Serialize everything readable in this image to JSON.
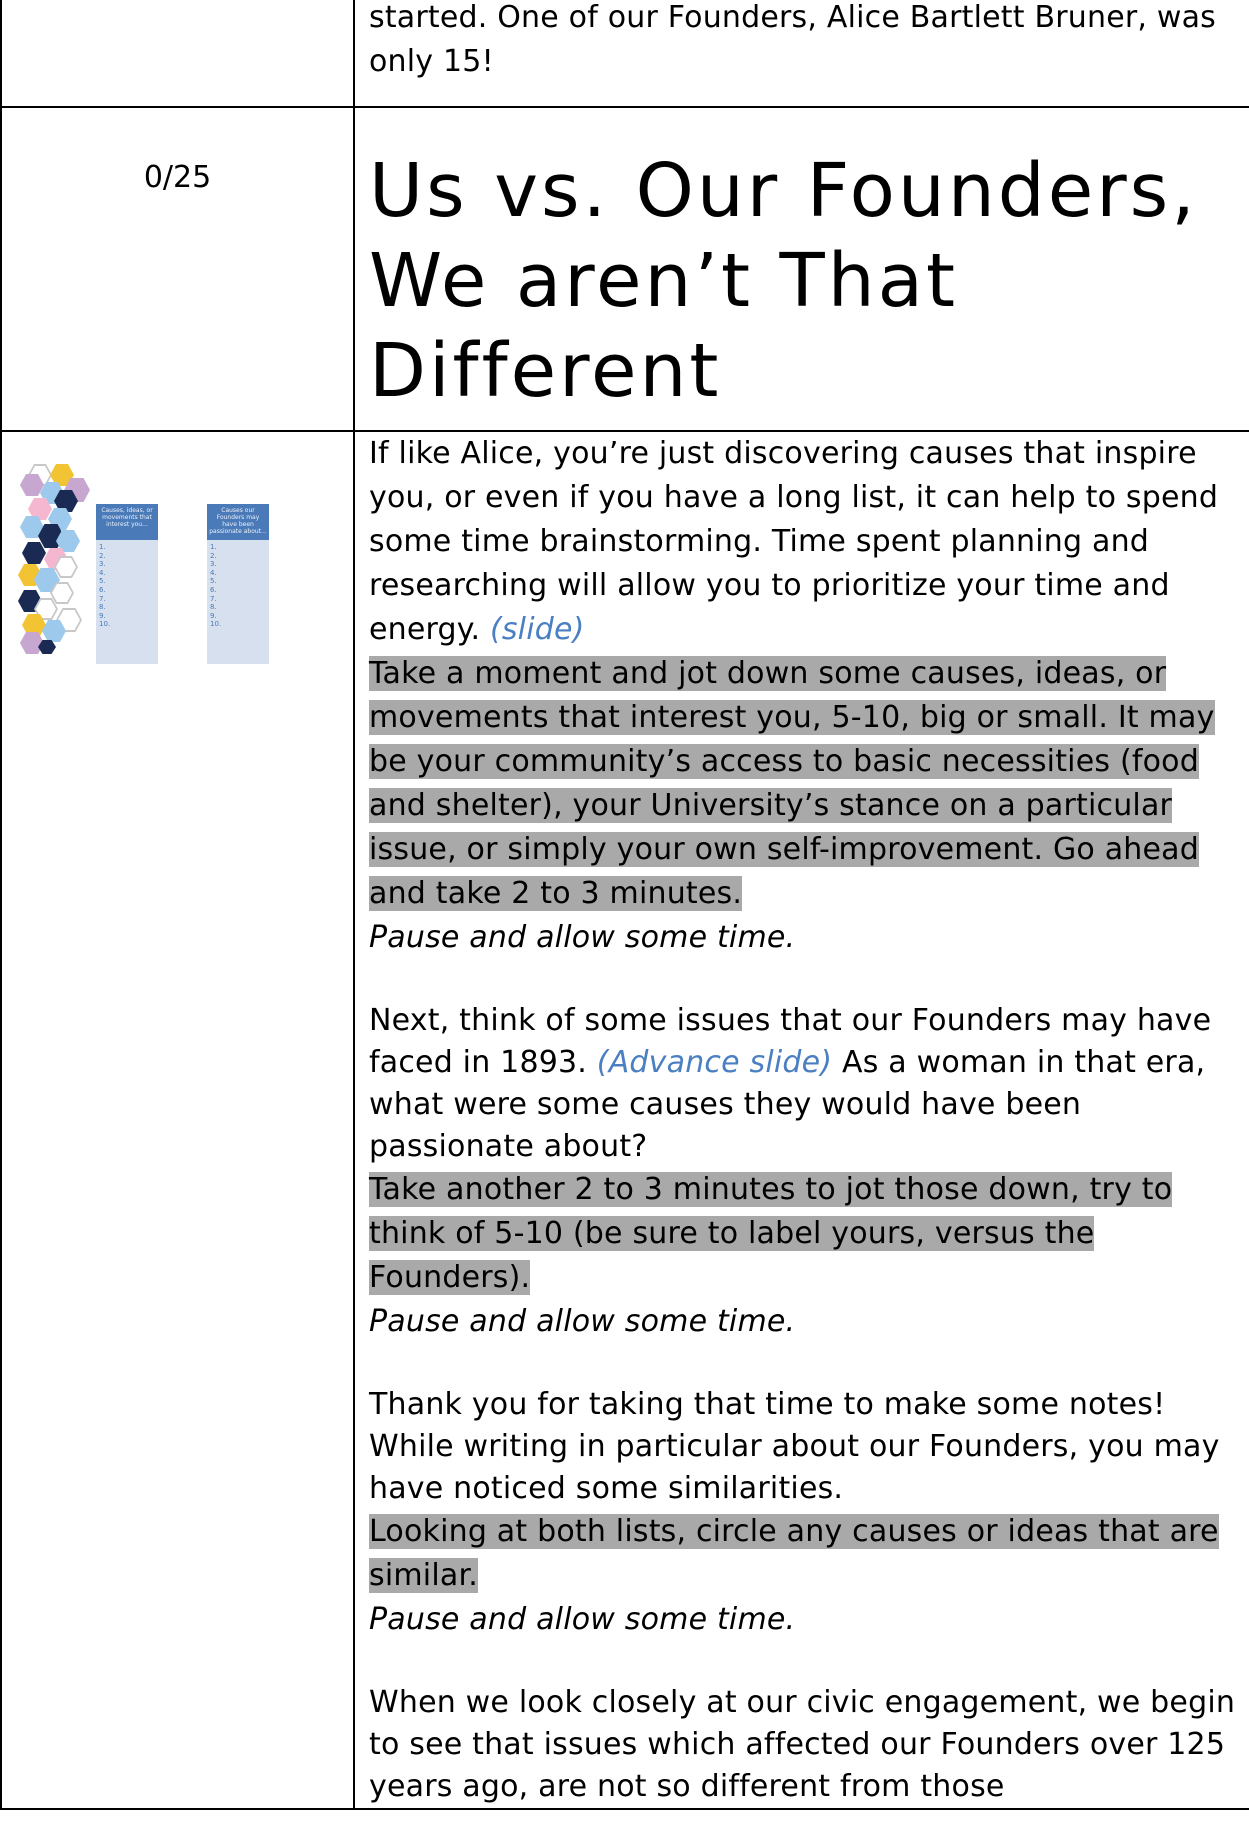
{
  "row1": {
    "text": "started. One of our Founders, Alice Bartlett Bruner, was only 15!"
  },
  "row2": {
    "timing": "0/25",
    "heading": "Us vs. Our Founders, We aren’t That Different"
  },
  "thumbnail": {
    "panel1": {
      "title": "Causes, ideas, or movements that interest you...",
      "items": [
        "1.",
        "2.",
        "3.",
        "4.",
        "5.",
        "6.",
        "7.",
        "8.",
        "9.",
        "10."
      ]
    },
    "panel2": {
      "title": "Causes our Founders may have been passionate about...",
      "items": [
        "1.",
        "2.",
        "3.",
        "4.",
        "5.",
        "6.",
        "7.",
        "8.",
        "9.",
        "10."
      ]
    },
    "colors": {
      "navy": "#1b2a52",
      "light_blue": "#9cc9ec",
      "pink": "#f5b6cf",
      "lavender": "#c7a6cf",
      "yellow": "#f2c434",
      "panel_header": "#4a7ab8",
      "panel_body": "#d6e0ee"
    }
  },
  "script": {
    "p1": "If like Alice, you’re just discovering causes that inspire you, or even if you have a long list, it can help to spend some time brainstorming. Time spent planning and researching will allow you to prioritize your time and energy.",
    "p1_slide": "(slide)",
    "hl1": "Take a moment and jot down some causes, ideas, or movements that interest you, 5-10, big or small. It may be your community’s access to basic necessities (food and shelter), your University’s stance on a particular issue, or simply your own self-improvement. Go ahead and take 2 to 3 minutes.",
    "pause1": "Pause and allow some time.",
    "p2a": "Next, think of some issues that our Founders may have faced in 1893.",
    "p2_slide": "(Advance slide)",
    "p2b": "As a woman in that era, what were some causes they would have been passionate about?",
    "hl2": "Take another 2 to 3 minutes to jot those down, try to think of 5-10 (be sure to label yours, versus the Founders).",
    "pause2": "Pause and allow some time.",
    "p3": "Thank you for taking that time to make some notes! While writing in particular about our Founders, you may have noticed some similarities.",
    "hl3": "Looking at both lists, circle any causes or ideas that are similar.",
    "pause3": "Pause and allow some time.",
    "p4": "When we look closely at our civic engagement, we begin to see that issues which affected our Founders over 125 years ago, are not so different from those"
  }
}
